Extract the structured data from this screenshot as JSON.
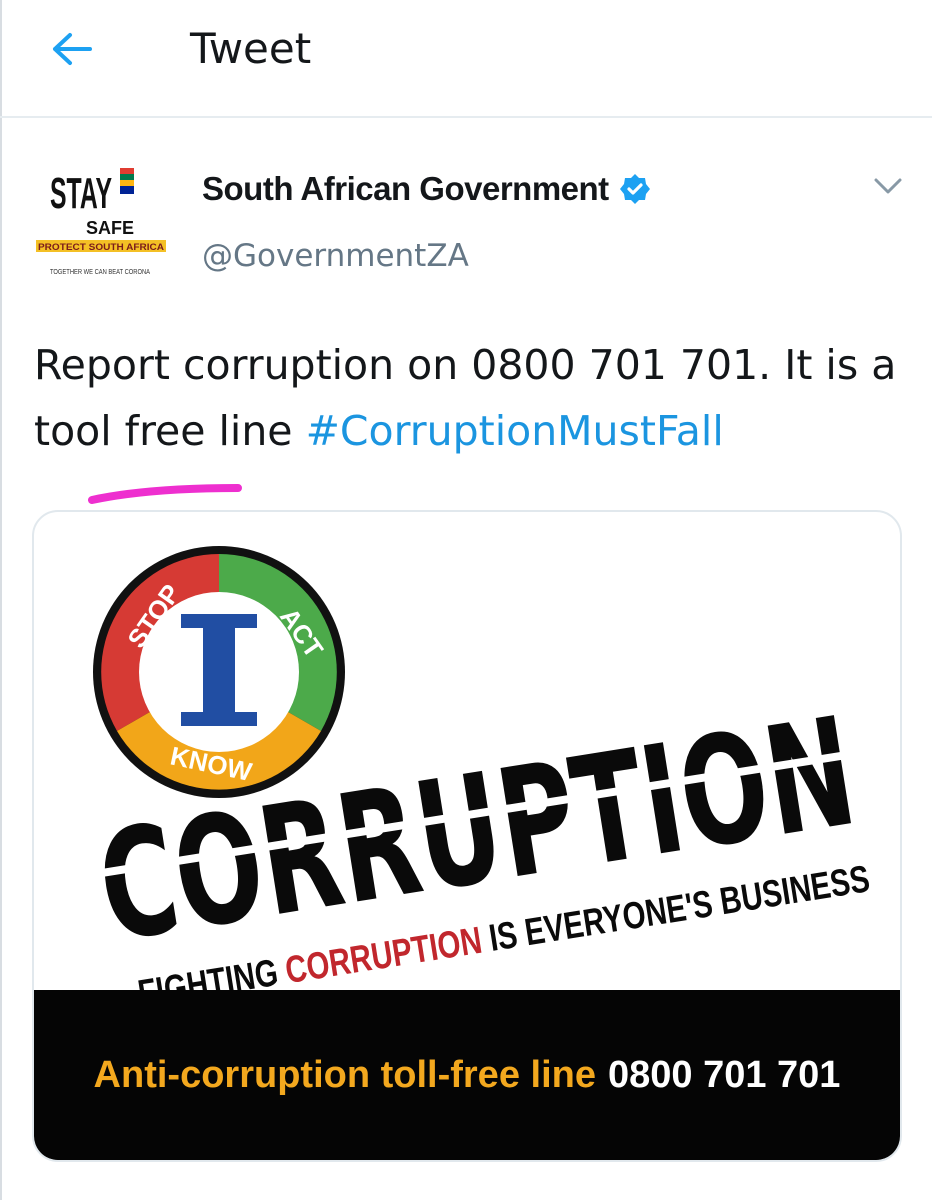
{
  "header": {
    "title": "Tweet",
    "back_icon": "arrow-left-icon"
  },
  "tweet": {
    "author": {
      "display_name": "South African Government",
      "handle": "@GovernmentZA",
      "verified": true,
      "avatar": {
        "line1": "STAY",
        "line2": "SAFE",
        "line3": "PROTECT SOUTH AFRICA",
        "line4": "TOGETHER WE CAN BEAT CORONA"
      }
    },
    "text_plain": "Report corruption on 0800 701 701. It is a tool free line ",
    "hashtag": "#CorruptionMustFall"
  },
  "media": {
    "logo_words": [
      "STOP",
      "ACT",
      "KNOW"
    ],
    "logo_letter": "I",
    "headline": "CORRUPTION",
    "tagline_start": "FIGHTING ",
    "tagline_highlight": "CORRUPTION",
    "tagline_end": " IS EVERYONE'S BUSINESS",
    "banner_label": "Anti-corruption toll-free line",
    "banner_number": "0800 701 701"
  },
  "colors": {
    "link": "#1b95e0",
    "banner_orange": "#f3a81e",
    "logo_red": "#d63a34",
    "logo_green": "#4caa4a",
    "logo_orange": "#f2a619",
    "logo_blue": "#214ea3",
    "highlight_red": "#c1272d",
    "pen_mark": "#ee2fcf"
  }
}
